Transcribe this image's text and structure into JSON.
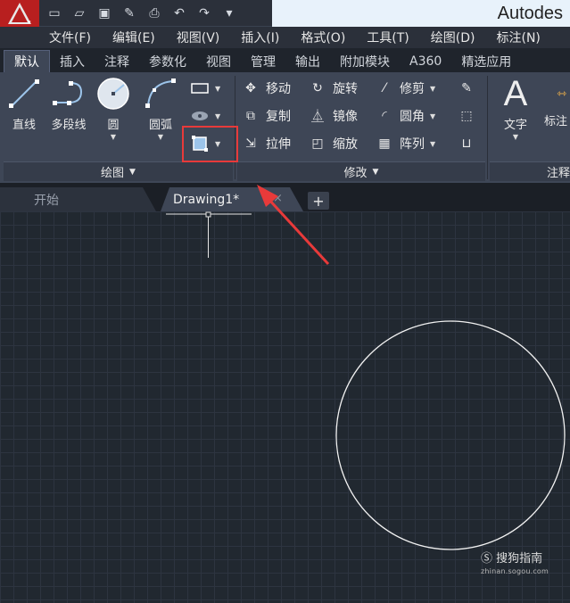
{
  "title_bar": {
    "app_title": "Autodes",
    "quick_access": [
      "new-icon",
      "open-icon",
      "save-icon",
      "saveas-icon",
      "print-icon",
      "undo-icon",
      "redo-icon",
      "customize-icon"
    ]
  },
  "menu": [
    "文件(F)",
    "编辑(E)",
    "视图(V)",
    "插入(I)",
    "格式(O)",
    "工具(T)",
    "绘图(D)",
    "标注(N)"
  ],
  "ribbon_tabs": [
    "默认",
    "插入",
    "注释",
    "参数化",
    "视图",
    "管理",
    "输出",
    "附加模块",
    "A360",
    "精选应用"
  ],
  "draw_panel": {
    "line": "直线",
    "polyline": "多段线",
    "circle": "圆",
    "arc": "圆弧",
    "footer": "绘图"
  },
  "modify_panel": {
    "move": "移动",
    "rotate": "旋转",
    "trim": "修剪",
    "copy": "复制",
    "mirror": "镜像",
    "fillet": "圆角",
    "stretch": "拉伸",
    "scale": "缩放",
    "array": "阵列",
    "footer": "修改"
  },
  "annotation_panel": {
    "text": "文字",
    "dimension": "标注",
    "footer": "注释"
  },
  "doc_tabs": {
    "start": "开始",
    "drawing": "Drawing1*",
    "close": "×",
    "add": "+"
  },
  "watermark": {
    "brand": "搜狗指南",
    "url": "zhinan.sogou.com"
  },
  "colors": {
    "highlight": "#e83a3a",
    "canvas": "#212830",
    "app_button": "#b81f1f"
  }
}
